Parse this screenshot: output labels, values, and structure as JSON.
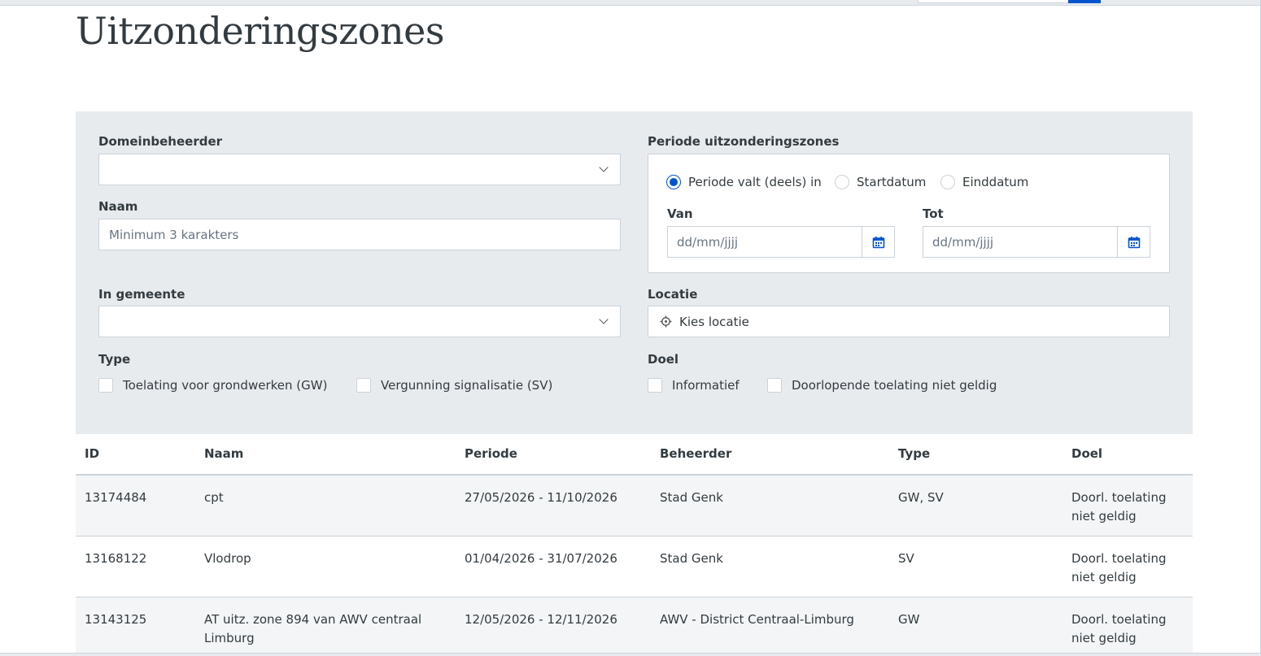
{
  "page": {
    "title": "Uitzonderingszones"
  },
  "filters": {
    "domeinbeheerder": {
      "label": "Domeinbeheerder",
      "value": ""
    },
    "naam": {
      "label": "Naam",
      "placeholder": "Minimum 3 karakters"
    },
    "gemeente": {
      "label": "In gemeente",
      "value": ""
    },
    "periode": {
      "label": "Periode uitzonderingszones",
      "options": [
        "Periode valt (deels) in",
        "Startdatum",
        "Einddatum"
      ],
      "selected": "Periode valt (deels) in",
      "van": {
        "label": "Van",
        "placeholder": "dd/mm/jjjj"
      },
      "tot": {
        "label": "Tot",
        "placeholder": "dd/mm/jjjj"
      }
    },
    "locatie": {
      "label": "Locatie",
      "placeholder": "Kies locatie"
    },
    "type": {
      "label": "Type",
      "options": [
        "Toelating voor grondwerken (GW)",
        "Vergunning signalisatie (SV)"
      ]
    },
    "doel": {
      "label": "Doel",
      "options": [
        "Informatief",
        "Doorlopende toelating niet geldig"
      ]
    }
  },
  "table": {
    "headers": [
      "ID",
      "Naam",
      "Periode",
      "Beheerder",
      "Type",
      "Doel"
    ],
    "rows": [
      {
        "id": "13174484",
        "naam": "cpt",
        "periode": "27/05/2026 - 11/10/2026",
        "beheerder": "Stad Genk",
        "type": "GW, SV",
        "doel": "Doorl. toelating niet geldig"
      },
      {
        "id": "13168122",
        "naam": "Vlodrop",
        "periode": "01/04/2026 - 31/07/2026",
        "beheerder": "Stad Genk",
        "type": "SV",
        "doel": "Doorl. toelating niet geldig"
      },
      {
        "id": "13143125",
        "naam": "AT uitz. zone 894 van AWV centraal Limburg",
        "periode": "12/05/2026 - 12/11/2026",
        "beheerder": "AWV - District Centraal-Limburg",
        "type": "GW",
        "doel": "Doorl. toelating niet geldig"
      }
    ]
  },
  "colors": {
    "accent": "#0055cc",
    "panel": "#e8ebee",
    "border": "#cbd2da",
    "text": "#333b40",
    "placeholder": "#687483"
  },
  "icons": {
    "calendar": "calendar-icon",
    "chevron": "chevron-down-icon",
    "location": "crosshair-icon"
  }
}
